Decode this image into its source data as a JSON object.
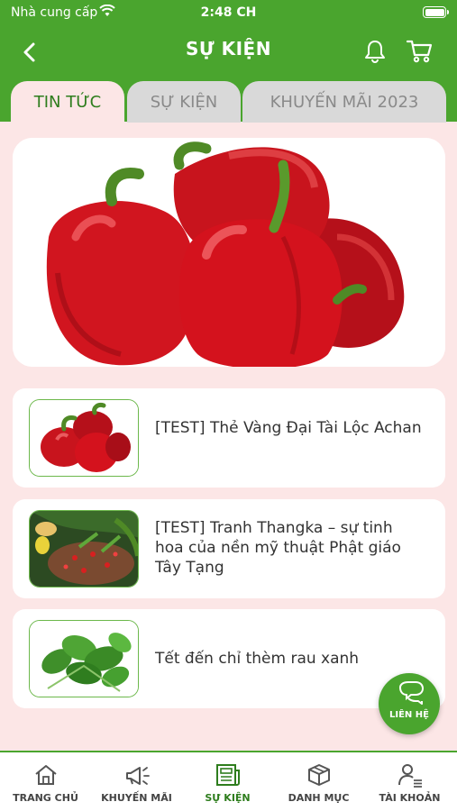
{
  "status_bar": {
    "carrier": "Nhà cung cấp",
    "time": "2:48 CH"
  },
  "header": {
    "title": "SỰ KIỆN"
  },
  "tabs": [
    {
      "label": "TIN TỨC",
      "active": true
    },
    {
      "label": "SỰ KIỆN",
      "active": false
    },
    {
      "label": "KHUYẾN MÃI 2023",
      "active": false
    }
  ],
  "news": [
    {
      "title": "[TEST] Thẻ Vàng Đại Tài Lộc Achan"
    },
    {
      "title": "[TEST] Tranh Thangka – sự tinh hoa của nền mỹ thuật Phật giáo Tây Tạng"
    },
    {
      "title": "Tết đến chỉ thèm rau xanh"
    }
  ],
  "fab": {
    "label": "LIÊN HỆ"
  },
  "bottom_nav": [
    {
      "label": "TRANG CHỦ",
      "icon": "home-icon"
    },
    {
      "label": "KHUYẾN MÃI",
      "icon": "megaphone-icon"
    },
    {
      "label": "SỰ KIỆN",
      "icon": "newspaper-icon",
      "active": true
    },
    {
      "label": "DANH MỤC",
      "icon": "box-icon"
    },
    {
      "label": "TÀI KHOẢN",
      "icon": "account-icon"
    }
  ],
  "colors": {
    "brand": "#4aa52e",
    "background": "#fce6e6",
    "tab_inactive": "#d9d9d9"
  }
}
